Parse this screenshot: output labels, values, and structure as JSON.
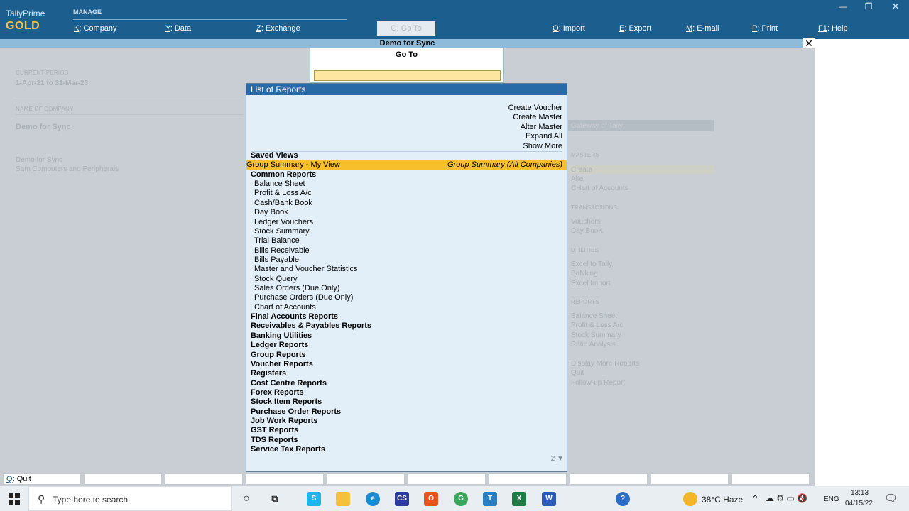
{
  "app": {
    "brand_line1": "TallyPrime",
    "brand_line2": "GOLD",
    "manage_label": "MANAGE",
    "window_controls": [
      "—",
      "❐",
      "✕"
    ]
  },
  "top_menu": [
    {
      "key": "K",
      "label": "Company"
    },
    {
      "key": "Y",
      "label": "Data"
    },
    {
      "key": "Z",
      "label": "Exchange"
    },
    {
      "key": "O",
      "label": "Import"
    },
    {
      "key": "E",
      "label": "Export"
    },
    {
      "key": "M",
      "label": "E-mail"
    },
    {
      "key": "P",
      "label": "Print"
    },
    {
      "key": "F1",
      "label": "Help"
    }
  ],
  "goto_button": {
    "key": "G",
    "label": "Go To"
  },
  "company_bar": {
    "title": "Demo for Sync",
    "close_glyph": "✕"
  },
  "background": {
    "period_label": "CURRENT PERIOD",
    "period_value": "1-Apr-21 to 31-Mar-23",
    "company_label": "NAME OF COMPANY",
    "company_value": "Demo for Sync",
    "company_lines": [
      "Demo for Sync",
      "Sam Computers and Peripherals"
    ],
    "gateway_title": "Gateway of Tally",
    "gateway_items": [
      "MASTERS",
      "Create",
      "Alter",
      "CHart of Accounts",
      "TRANSACTIONS",
      "Vouchers",
      "Day BooK",
      "UTILITIES",
      "Excel to Tally",
      "BaNking",
      "Excel Import",
      "REPORTS",
      "Balance Sheet",
      "Profit & Loss A/c",
      "Stock Summary",
      "Ratio Analysis",
      "Display More Reports",
      "Quit",
      "Follow-up Report"
    ]
  },
  "goto_panel": {
    "title": "Go To",
    "value": ""
  },
  "list_of_reports": {
    "title": "List of Reports",
    "actions": [
      "Create Voucher",
      "Create Master",
      "Alter Master",
      "Expand All",
      "Show More"
    ],
    "rows": [
      {
        "text": "Saved Views",
        "type": "h"
      },
      {
        "text": "Group Summary - My View",
        "type": "sel",
        "meta": "Group Summary (All Companies)"
      },
      {
        "text": "Common Reports",
        "type": "h"
      },
      {
        "text": "Balance Sheet",
        "type": "i"
      },
      {
        "text": "Profit & Loss A/c",
        "type": "i"
      },
      {
        "text": "Cash/Bank Book",
        "type": "i"
      },
      {
        "text": "Day Book",
        "type": "i"
      },
      {
        "text": "Ledger Vouchers",
        "type": "i"
      },
      {
        "text": "Stock Summary",
        "type": "i"
      },
      {
        "text": "Trial Balance",
        "type": "i"
      },
      {
        "text": "Bills Receivable",
        "type": "i"
      },
      {
        "text": "Bills Payable",
        "type": "i"
      },
      {
        "text": "Master and Voucher Statistics",
        "type": "i"
      },
      {
        "text": "Stock Query",
        "type": "i"
      },
      {
        "text": "Sales Orders (Due Only)",
        "type": "i"
      },
      {
        "text": "Purchase Orders (Due Only)",
        "type": "i"
      },
      {
        "text": "Chart of Accounts",
        "type": "i"
      },
      {
        "text": "Final Accounts Reports",
        "type": "h"
      },
      {
        "text": "Receivables & Payables Reports",
        "type": "h"
      },
      {
        "text": "Banking Utilities",
        "type": "h"
      },
      {
        "text": "Ledger Reports",
        "type": "h"
      },
      {
        "text": "Group Reports",
        "type": "h"
      },
      {
        "text": "Voucher Reports",
        "type": "h"
      },
      {
        "text": "Registers",
        "type": "h"
      },
      {
        "text": "Cost Centre Reports",
        "type": "h"
      },
      {
        "text": "Forex Reports",
        "type": "h"
      },
      {
        "text": "Stock Item Reports",
        "type": "h"
      },
      {
        "text": "Purchase Order Reports",
        "type": "h"
      },
      {
        "text": "Job Work Reports",
        "type": "h"
      },
      {
        "text": "GST Reports",
        "type": "h"
      },
      {
        "text": "TDS Reports",
        "type": "h"
      },
      {
        "text": "Service Tax Reports",
        "type": "h"
      }
    ],
    "pager": "2 ▼"
  },
  "bottom_bar": {
    "quit_key": "Q",
    "quit_label": "Quit"
  },
  "taskbar": {
    "search_placeholder": "Type here to search",
    "weather": "38°C  Haze",
    "lang": "ENG",
    "time": "13:13",
    "date": "04/15/22",
    "icons": [
      "cortana-icon",
      "task-view-icon",
      "app-s-icon",
      "file-explorer-icon",
      "edge-icon",
      "cs-icon",
      "office-icon",
      "chrome-icon",
      "tally-icon",
      "excel-icon",
      "word-icon",
      "help-icon"
    ]
  }
}
